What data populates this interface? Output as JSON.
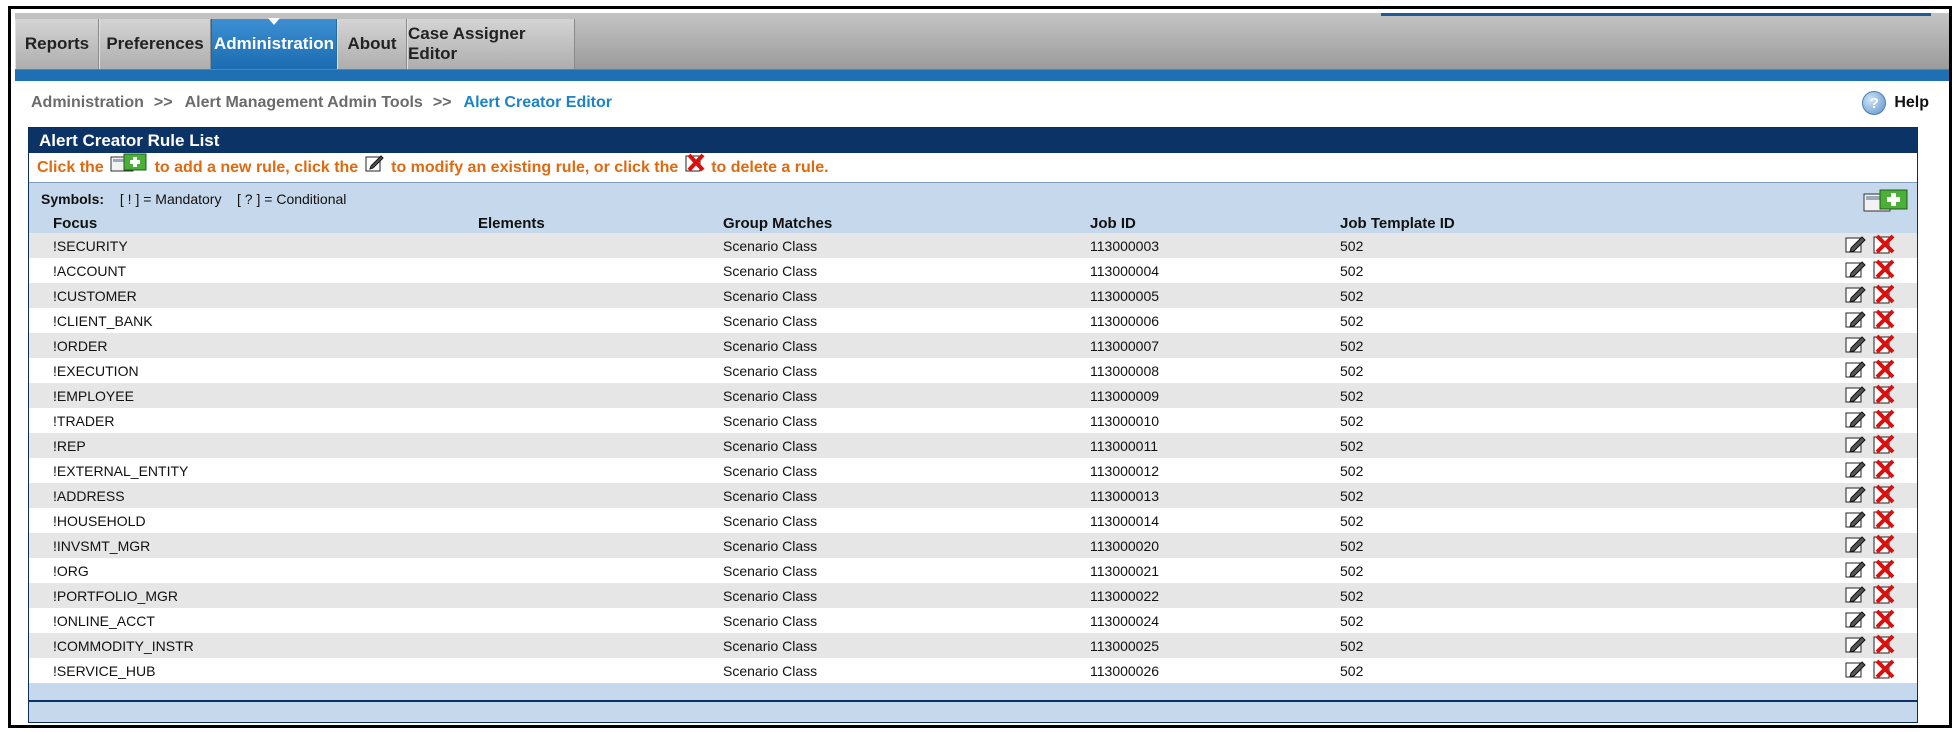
{
  "nav": {
    "tabs": [
      {
        "label": "Reports",
        "active": false
      },
      {
        "label": "Preferences",
        "active": false
      },
      {
        "label": "Administration",
        "active": true
      },
      {
        "label": "About",
        "active": false
      },
      {
        "label": "Case Assigner Editor",
        "active": false
      }
    ]
  },
  "breadcrumb": {
    "items": [
      "Administration",
      "Alert Management Admin Tools",
      "Alert Creator Editor"
    ],
    "separator": ">>"
  },
  "help": {
    "label": "Help",
    "icon": "help-icon"
  },
  "panel": {
    "title": "Alert Creator Rule List",
    "instructions": {
      "part1": "Click the",
      "part2": "to add a new rule, click the",
      "part3": "to modify an existing rule, or click the",
      "part4": "to delete a rule."
    },
    "symbols": {
      "label": "Symbols:",
      "mandatory": "[ ! ] = Mandatory",
      "conditional": "[ ? ] = Conditional"
    }
  },
  "table": {
    "headers": [
      "Focus",
      "Elements",
      "Group Matches",
      "Job ID",
      "Job Template ID"
    ],
    "rows": [
      {
        "focus": "!SECURITY",
        "elements": "",
        "group": "Scenario Class",
        "job_id": "113000003",
        "template_id": "502"
      },
      {
        "focus": "!ACCOUNT",
        "elements": "",
        "group": "Scenario Class",
        "job_id": "113000004",
        "template_id": "502"
      },
      {
        "focus": "!CUSTOMER",
        "elements": "",
        "group": "Scenario Class",
        "job_id": "113000005",
        "template_id": "502"
      },
      {
        "focus": "!CLIENT_BANK",
        "elements": "",
        "group": "Scenario Class",
        "job_id": "113000006",
        "template_id": "502"
      },
      {
        "focus": "!ORDER",
        "elements": "",
        "group": "Scenario Class",
        "job_id": "113000007",
        "template_id": "502"
      },
      {
        "focus": "!EXECUTION",
        "elements": "",
        "group": "Scenario Class",
        "job_id": "113000008",
        "template_id": "502"
      },
      {
        "focus": "!EMPLOYEE",
        "elements": "",
        "group": "Scenario Class",
        "job_id": "113000009",
        "template_id": "502"
      },
      {
        "focus": "!TRADER",
        "elements": "",
        "group": "Scenario Class",
        "job_id": "113000010",
        "template_id": "502"
      },
      {
        "focus": "!REP",
        "elements": "",
        "group": "Scenario Class",
        "job_id": "113000011",
        "template_id": "502"
      },
      {
        "focus": "!EXTERNAL_ENTITY",
        "elements": "",
        "group": "Scenario Class",
        "job_id": "113000012",
        "template_id": "502"
      },
      {
        "focus": "!ADDRESS",
        "elements": "",
        "group": "Scenario Class",
        "job_id": "113000013",
        "template_id": "502"
      },
      {
        "focus": "!HOUSEHOLD",
        "elements": "",
        "group": "Scenario Class",
        "job_id": "113000014",
        "template_id": "502"
      },
      {
        "focus": "!INVSMT_MGR",
        "elements": "",
        "group": "Scenario Class",
        "job_id": "113000020",
        "template_id": "502"
      },
      {
        "focus": "!ORG",
        "elements": "",
        "group": "Scenario Class",
        "job_id": "113000021",
        "template_id": "502"
      },
      {
        "focus": "!PORTFOLIO_MGR",
        "elements": "",
        "group": "Scenario Class",
        "job_id": "113000022",
        "template_id": "502"
      },
      {
        "focus": "!ONLINE_ACCT",
        "elements": "",
        "group": "Scenario Class",
        "job_id": "113000024",
        "template_id": "502"
      },
      {
        "focus": "!COMMODITY_INSTR",
        "elements": "",
        "group": "Scenario Class",
        "job_id": "113000025",
        "template_id": "502"
      },
      {
        "focus": "!SERVICE_HUB",
        "elements": "",
        "group": "Scenario Class",
        "job_id": "113000026",
        "template_id": "502"
      }
    ],
    "row_actions": [
      "edit-icon",
      "delete-icon"
    ]
  },
  "colors": {
    "nav_active": "#1b6cb0",
    "panel_header": "#0c3366",
    "instruction_text": "#e06a10",
    "breadcrumb_current": "#1d83c9",
    "list_background": "#c6d9ec",
    "row_alt": "#e6e6e6"
  }
}
